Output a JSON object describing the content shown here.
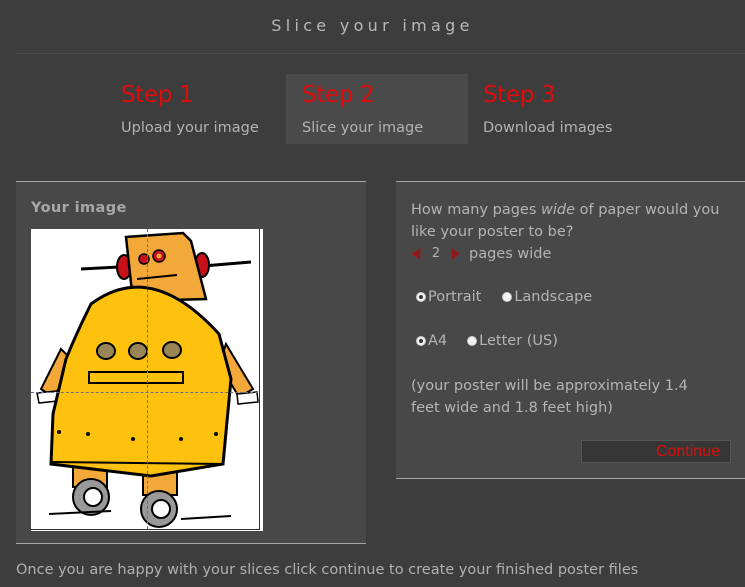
{
  "header": {
    "title": "Slice your image"
  },
  "steps": [
    {
      "number": "Step 1",
      "description": "Upload your image",
      "active": false
    },
    {
      "number": "Step 2",
      "description": "Slice your image",
      "active": true
    },
    {
      "number": "Step 3",
      "description": "Download images",
      "active": false
    }
  ],
  "image_panel": {
    "title": "Your image",
    "image_description": "cartoon yellow robot with red ears and wheels",
    "slices": {
      "columns": 2,
      "rows": 2
    }
  },
  "options_panel": {
    "question_prefix": "How many pages ",
    "question_emphasis": "wide",
    "question_suffix": " of paper would you like your poster to be?",
    "pages_wide_value": "2",
    "pages_wide_label": "pages wide",
    "decrease_icon": "left-triangle-arrow",
    "increase_icon": "right-triangle-arrow",
    "orientation": {
      "options": [
        {
          "label": "Portrait",
          "checked": true
        },
        {
          "label": "Landscape",
          "checked": false
        }
      ]
    },
    "paper_size": {
      "options": [
        {
          "label": "A4",
          "checked": true
        },
        {
          "label": "Letter (US)",
          "checked": false
        }
      ]
    },
    "size_estimate": "(your poster will be approximately 1.4 feet wide and 1.8 feet high)",
    "continue_label": "Continue"
  },
  "footer": {
    "text": "Once you are happy with your slices click continue to create your finished poster files"
  },
  "colors": {
    "background": "#3d3d3d",
    "panel": "#484848",
    "accent_red": "#e00b0b",
    "text": "#b4b4b4"
  }
}
